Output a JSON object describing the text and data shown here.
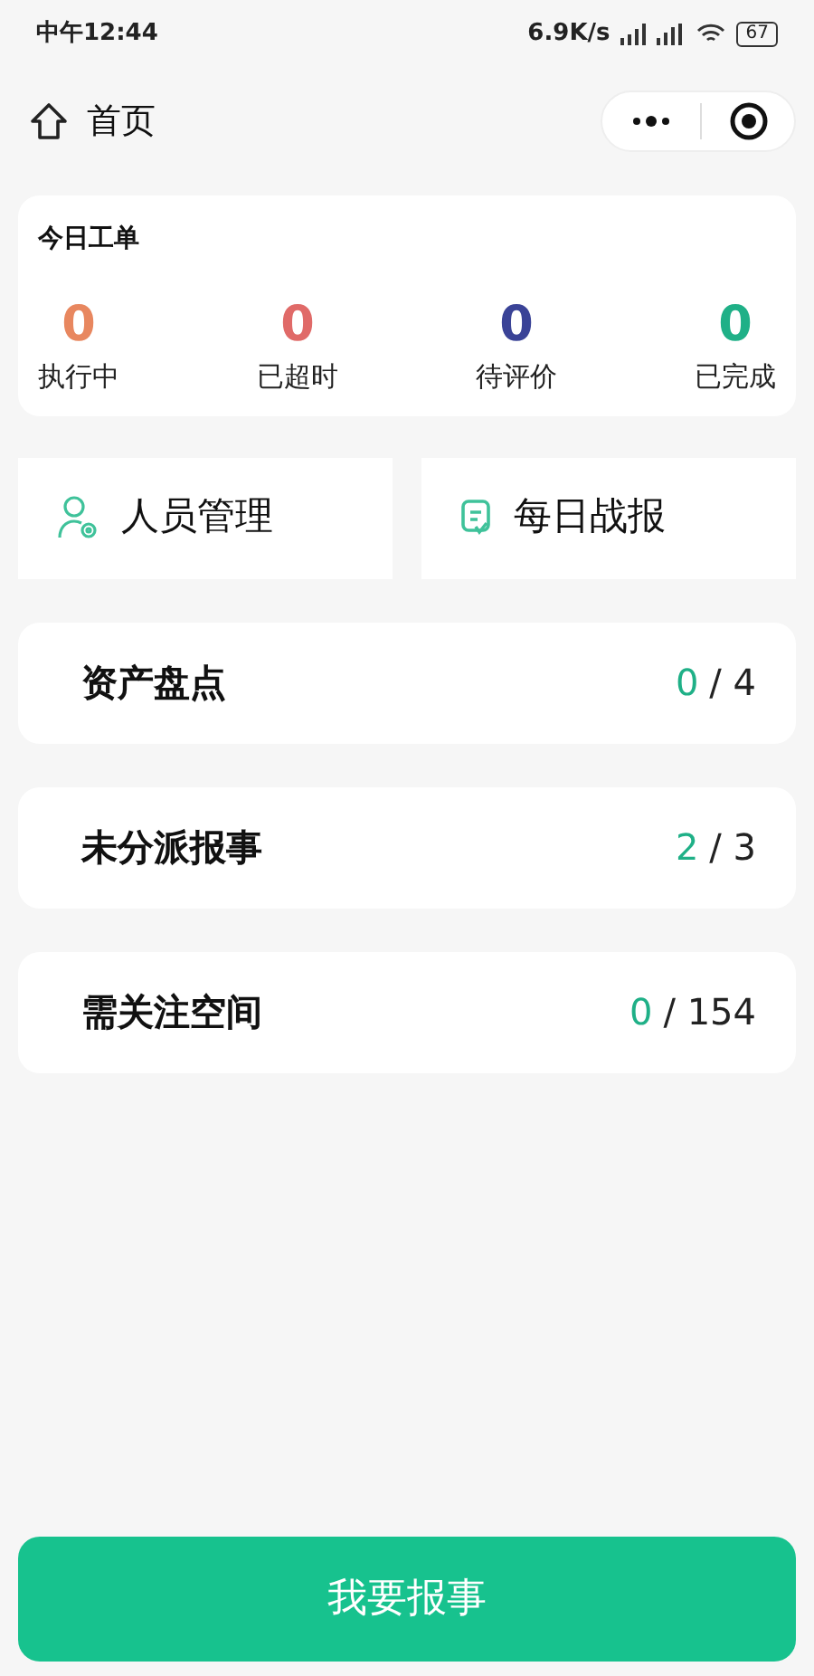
{
  "status_bar": {
    "time": "中午12:44",
    "speed": "6.9K/s",
    "battery": "67"
  },
  "nav": {
    "title": "首页"
  },
  "today": {
    "title": "今日工单",
    "stats": [
      {
        "value": "0",
        "label": "执行中",
        "color": "#e8875f"
      },
      {
        "value": "0",
        "label": "已超时",
        "color": "#e06a68"
      },
      {
        "value": "0",
        "label": "待评价",
        "color": "#3a4397"
      },
      {
        "value": "0",
        "label": "已完成",
        "color": "#1fb087"
      }
    ]
  },
  "shortcuts": [
    {
      "label": "人员管理",
      "kind": "people"
    },
    {
      "label": "每日战报",
      "kind": "report"
    }
  ],
  "counters": [
    {
      "title": "资产盘点",
      "value": "0",
      "total": "/ 4"
    },
    {
      "title": "未分派报事",
      "value": "2",
      "total": "/ 3"
    },
    {
      "title": "需关注空间",
      "value": "0",
      "total": "/ 154"
    }
  ],
  "action": {
    "label": "我要报事"
  }
}
